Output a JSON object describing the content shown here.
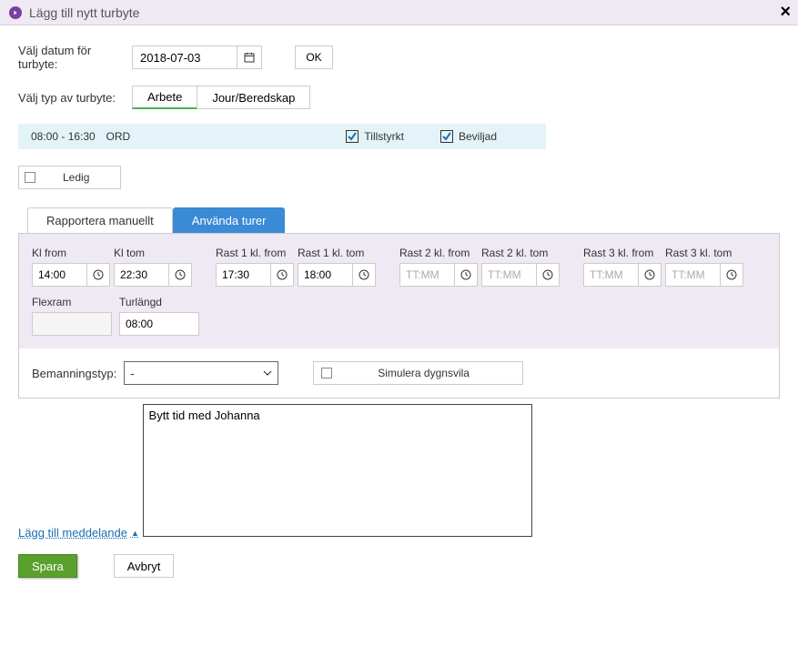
{
  "header": {
    "title": "Lägg till nytt turbyte"
  },
  "datePicker": {
    "label": "Välj datum för turbyte:",
    "value": "2018-07-03",
    "okLabel": "OK"
  },
  "typePicker": {
    "label": "Välj typ av turbyte:",
    "options": [
      "Arbete",
      "Jour/Beredskap"
    ],
    "active": 0
  },
  "shift": {
    "time": "08:00 - 16:30",
    "type": "ORD",
    "tillstyrktLabel": "Tillstyrkt",
    "beviljadLabel": "Beviljad"
  },
  "ledig": {
    "label": "Ledig",
    "checked": false
  },
  "tabs": {
    "items": [
      "Rapportera manuellt",
      "Använda turer"
    ],
    "active": 0
  },
  "times": {
    "klFrom": {
      "label": "Kl from",
      "value": "14:00"
    },
    "klTom": {
      "label": "Kl tom",
      "value": "22:30"
    },
    "rast1From": {
      "label": "Rast 1 kl. from",
      "value": "17:30"
    },
    "rast1Tom": {
      "label": "Rast 1 kl. tom",
      "value": "18:00"
    },
    "rast2From": {
      "label": "Rast 2 kl. from",
      "value": "",
      "placeholder": "TT:MM"
    },
    "rast2Tom": {
      "label": "Rast 2 kl. tom",
      "value": "",
      "placeholder": "TT:MM"
    },
    "rast3From": {
      "label": "Rast 3 kl. from",
      "value": "",
      "placeholder": "TT:MM"
    },
    "rast3Tom": {
      "label": "Rast 3 kl. tom",
      "value": "",
      "placeholder": "TT:MM"
    },
    "flexram": {
      "label": "Flexram",
      "value": ""
    },
    "turlangd": {
      "label": "Turlängd",
      "value": "08:00"
    }
  },
  "bemanning": {
    "label": "Bemanningstyp:",
    "value": "-"
  },
  "simulera": {
    "label": "Simulera dygnsvila",
    "checked": false
  },
  "addMessage": {
    "label": "Lägg till meddelande"
  },
  "message": {
    "value": "Bytt tid med Johanna"
  },
  "actions": {
    "save": "Spara",
    "cancel": "Avbryt"
  }
}
